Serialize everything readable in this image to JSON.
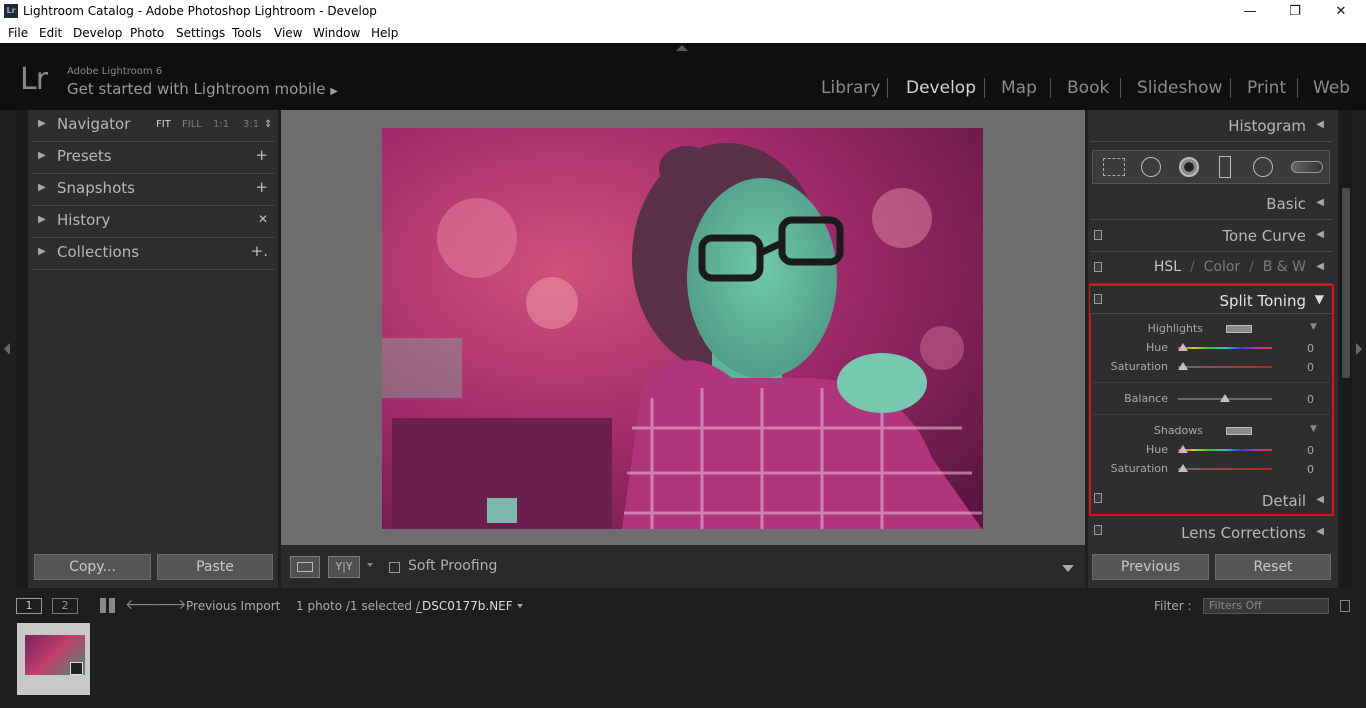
{
  "window": {
    "title": "Lightroom Catalog - Adobe Photoshop Lightroom - Develop",
    "app_icon": "Lr",
    "controls": {
      "minimize": "—",
      "restore": "❐",
      "close": "✕"
    }
  },
  "menu": [
    "File",
    "Edit",
    "Develop",
    "Photo",
    "Settings",
    "Tools",
    "View",
    "Window",
    "Help"
  ],
  "header": {
    "logo": "Lr",
    "version": "Adobe Lightroom 6",
    "mobile_link": "Get started with Lightroom mobile",
    "mobile_arrow": "▶",
    "modules": [
      "Library",
      "Develop",
      "Map",
      "Book",
      "Slideshow",
      "Print",
      "Web"
    ],
    "active_module": "Develop"
  },
  "left_panel": {
    "navigator": {
      "label": "Navigator",
      "options": [
        "FIT",
        "FILL",
        "1:1",
        "3:1"
      ],
      "options_arrow": "⇕"
    },
    "presets": {
      "label": "Presets",
      "action": "+"
    },
    "snapshots": {
      "label": "Snapshots",
      "action": "+"
    },
    "history": {
      "label": "History",
      "action": "✕"
    },
    "collections": {
      "label": "Collections",
      "action": "+."
    },
    "copy_button": "Copy...",
    "paste_button": "Paste"
  },
  "toolbar": {
    "compare_label": "Y|Y",
    "soft_proofing": "Soft Proofing",
    "soft_proofing_checked": false
  },
  "right_panel": {
    "histogram": "Histogram",
    "basic": "Basic",
    "tone_curve": "Tone Curve",
    "hsl": {
      "hsl": "HSL",
      "sep1": "/",
      "color": "Color",
      "sep2": "/",
      "bw": "B & W"
    },
    "split_toning": {
      "label": "Split Toning",
      "highlights": {
        "label": "Highlights",
        "hue_label": "Hue",
        "hue": "0",
        "saturation_label": "Saturation",
        "saturation": "0"
      },
      "balance": {
        "label": "Balance",
        "value": "0"
      },
      "shadows": {
        "label": "Shadows",
        "hue_label": "Hue",
        "hue": "0",
        "saturation_label": "Saturation",
        "saturation": "0"
      },
      "highlight_color": "#e0101a"
    },
    "detail": "Detail",
    "lens_corrections": "Lens Corrections",
    "previous_button": "Previous",
    "reset_button": "Reset"
  },
  "filmstrip": {
    "screen1": "1",
    "screen2": "2",
    "source": "Previous Import",
    "count": "1 photo /1 selected /",
    "filename": "_DSC0177b.NEF",
    "filter_label": "Filter :",
    "filter_value": "Filters Off"
  }
}
